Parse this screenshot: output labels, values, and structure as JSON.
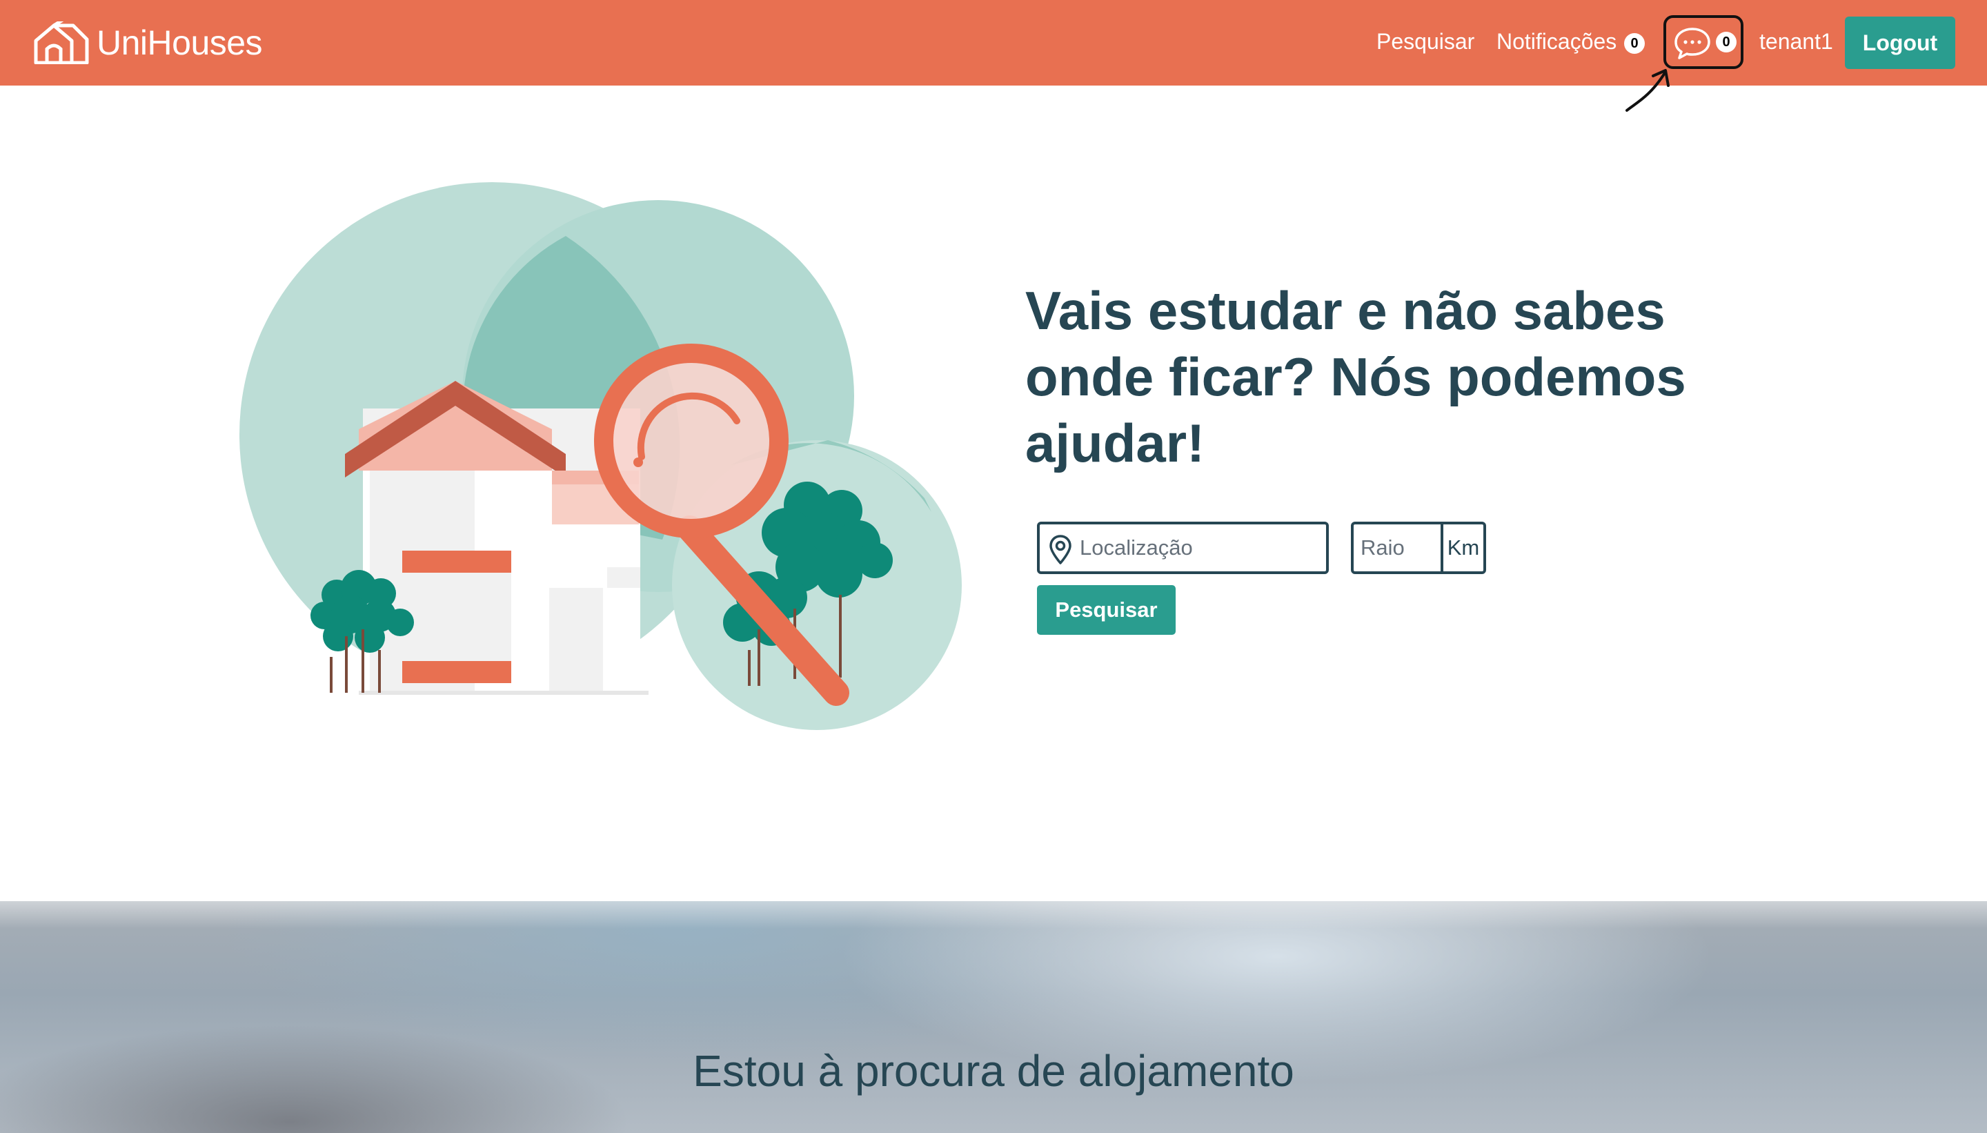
{
  "navbar": {
    "brand": "UniHouses",
    "search_link": "Pesquisar",
    "notifications_link": "Notificações",
    "notifications_count": "0",
    "messages_count": "0",
    "username": "tenant1",
    "logout_label": "Logout"
  },
  "hero": {
    "heading": "Vais estudar e não sabes onde ficar? Nós podemos ajudar!",
    "location_placeholder": "Localização",
    "radius_placeholder": "Raio",
    "radius_unit": "Km",
    "search_button": "Pesquisar"
  },
  "banner": {
    "title": "Estou à procura de alojamento"
  },
  "colors": {
    "navbar": "#e87051",
    "accent": "#2a9d8f",
    "heading": "#264653",
    "circle_light": "#bcddd6",
    "circle_mid": "#88c4b9",
    "house_roof": "#c05a45",
    "house_wall_pink": "#f4b6a8",
    "magnifier": "#e87051",
    "tree": "#0e8a78"
  },
  "icons": {
    "brand": "house-logo-icon",
    "messages": "chat-bubble-icon",
    "location": "location-pin-icon",
    "annotation": "annotation-arrow-icon"
  }
}
